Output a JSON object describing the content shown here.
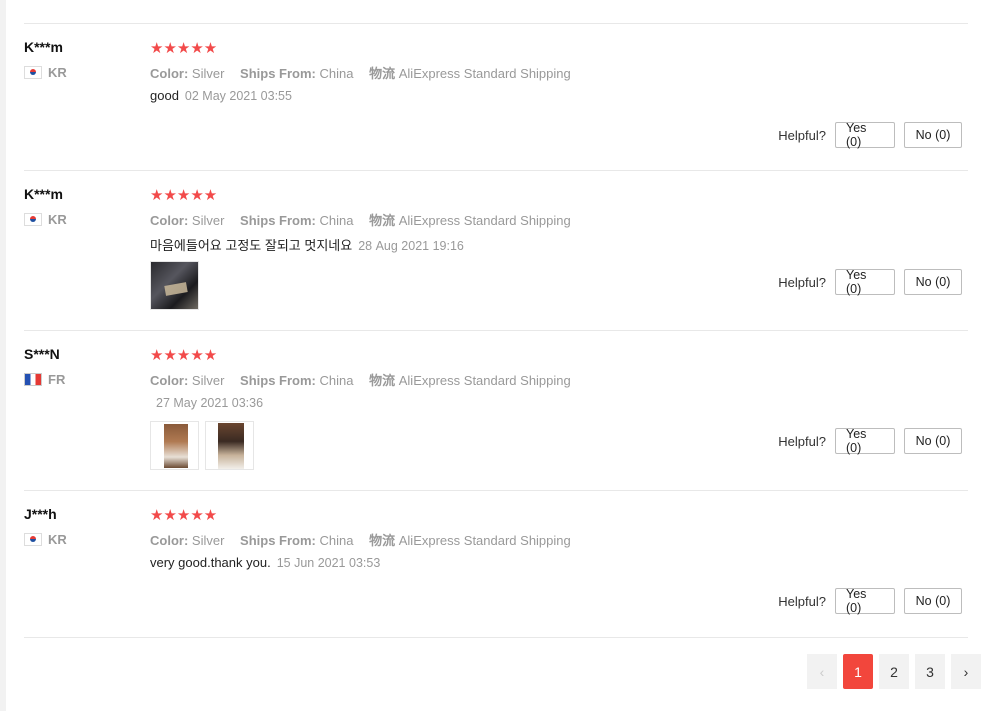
{
  "reviews": [
    {
      "user": "K***m",
      "country": "KR",
      "stars": "★★★★★",
      "color_label": "Color:",
      "color_value": "Silver",
      "ships_label": "Ships From:",
      "ships_value": "China",
      "logistics_label": "物流",
      "logistics_value": "AliExpress Standard Shipping",
      "text": "good",
      "date": "02 May 2021 03:55",
      "helpful_label": "Helpful?",
      "yes": "Yes (0)",
      "no": "No (0)"
    },
    {
      "user": "K***m",
      "country": "KR",
      "stars": "★★★★★",
      "color_label": "Color:",
      "color_value": "Silver",
      "ships_label": "Ships From:",
      "ships_value": "China",
      "logistics_label": "物流",
      "logistics_value": "AliExpress Standard Shipping",
      "text": "마음에들어요 고정도 잘되고 멋지네요",
      "date": "28 Aug 2021 19:16",
      "helpful_label": "Helpful?",
      "yes": "Yes (0)",
      "no": "No (0)"
    },
    {
      "user": "S***N",
      "country": "FR",
      "stars": "★★★★★",
      "color_label": "Color:",
      "color_value": "Silver",
      "ships_label": "Ships From:",
      "ships_value": "China",
      "logistics_label": "物流",
      "logistics_value": "AliExpress Standard Shipping",
      "text": "",
      "date": "27 May 2021 03:36",
      "helpful_label": "Helpful?",
      "yes": "Yes (0)",
      "no": "No (0)"
    },
    {
      "user": "J***h",
      "country": "KR",
      "stars": "★★★★★",
      "color_label": "Color:",
      "color_value": "Silver",
      "ships_label": "Ships From:",
      "ships_value": "China",
      "logistics_label": "物流",
      "logistics_value": "AliExpress Standard Shipping",
      "text": "very good.thank you.",
      "date": "15 Jun 2021 03:53",
      "helpful_label": "Helpful?",
      "yes": "Yes (0)",
      "no": "No (0)"
    }
  ],
  "pagination": {
    "prev": "‹",
    "pages": [
      "1",
      "2",
      "3"
    ],
    "active": "1",
    "next": "›"
  },
  "colors": {
    "star": "#f24a4a",
    "active_page": "#f2463c"
  }
}
